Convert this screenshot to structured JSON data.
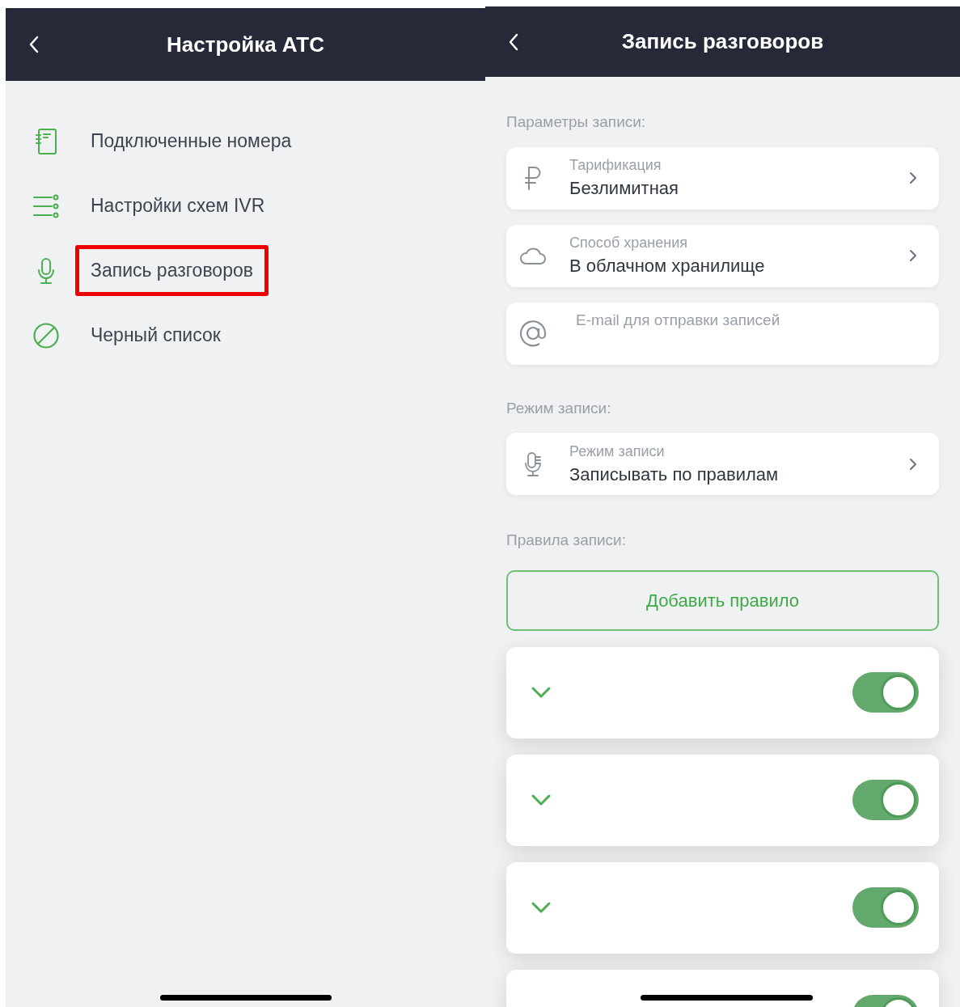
{
  "left_screen": {
    "title": "Настройка АТС",
    "menu": [
      {
        "kind": "notebook",
        "label": "Подключенные номера",
        "highlighted": false
      },
      {
        "kind": "list",
        "label": "Настройки схем IVR",
        "highlighted": false
      },
      {
        "kind": "mic",
        "label": "Запись разговоров",
        "highlighted": true
      },
      {
        "kind": "block",
        "label": "Черный список",
        "highlighted": false
      }
    ]
  },
  "right_screen": {
    "title": "Запись разговоров",
    "sections": [
      {
        "heading": "Параметры записи:",
        "items": [
          {
            "kind": "select",
            "caption": "Тарификация",
            "value": "Безлимитная"
          },
          {
            "kind": "select",
            "caption": "Способ хранения",
            "value": "В облачном хранилище"
          },
          {
            "kind": "input",
            "placeholder": "E-mail для отправки записей"
          }
        ]
      },
      {
        "heading": "Режим записи:",
        "items": [
          {
            "kind": "select",
            "caption": "Режим записи",
            "value": "Записывать по правилам"
          }
        ]
      }
    ],
    "rules_heading": "Правила записи:",
    "add_button": "Добавить правило",
    "rules": [
      {
        "expanded": false,
        "on": true
      },
      {
        "expanded": false,
        "on": true
      },
      {
        "expanded": false,
        "on": true
      },
      {
        "on": true
      }
    ]
  }
}
